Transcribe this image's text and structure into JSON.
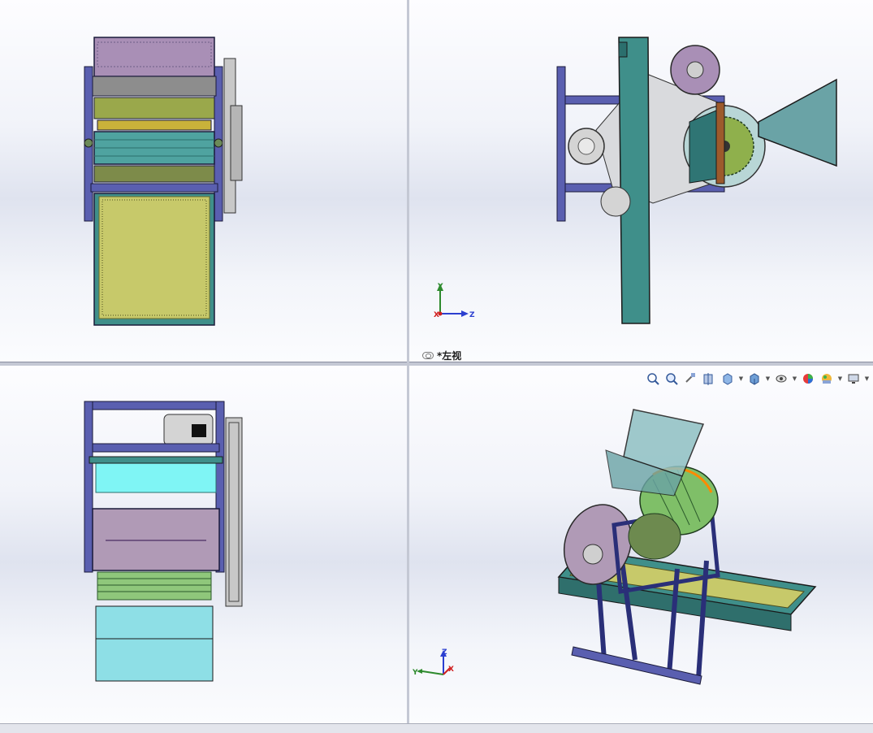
{
  "window": {
    "title": ""
  },
  "viewports": {
    "top_left": {
      "view": "top"
    },
    "top_right": {
      "view": "left",
      "label": "*左视"
    },
    "bottom_left": {
      "view": "front"
    },
    "bottom_right": {
      "view": "isometric"
    }
  },
  "triads": {
    "top_right": {
      "y": "Y",
      "x": "X",
      "z": "Z"
    },
    "bottom_right": {
      "z": "Z",
      "y": "Y",
      "x": "X"
    }
  },
  "heads_up_toolbar": {
    "items": [
      {
        "icon": "zoom-to-fit-icon"
      },
      {
        "icon": "zoom-to-area-icon"
      },
      {
        "icon": "previous-view-icon"
      },
      {
        "icon": "section-view-icon"
      },
      {
        "icon": "view-orientation-icon",
        "dropdown": true
      },
      {
        "icon": "display-style-icon",
        "dropdown": true
      },
      {
        "icon": "hide-show-items-icon",
        "dropdown": true
      },
      {
        "icon": "edit-appearance-icon"
      },
      {
        "icon": "apply-scene-icon",
        "dropdown": true
      },
      {
        "icon": "view-settings-icon",
        "dropdown": true
      }
    ]
  },
  "colors": {
    "frame": "#5a5fb0",
    "teal_panel": "#3f8f8a",
    "mesh": "#c7c96a",
    "drum_purple": "#a98fb6",
    "motor": "#d4d4d4",
    "hopper": "#6aa3a6",
    "highlight_orange": "#ff8a00"
  }
}
